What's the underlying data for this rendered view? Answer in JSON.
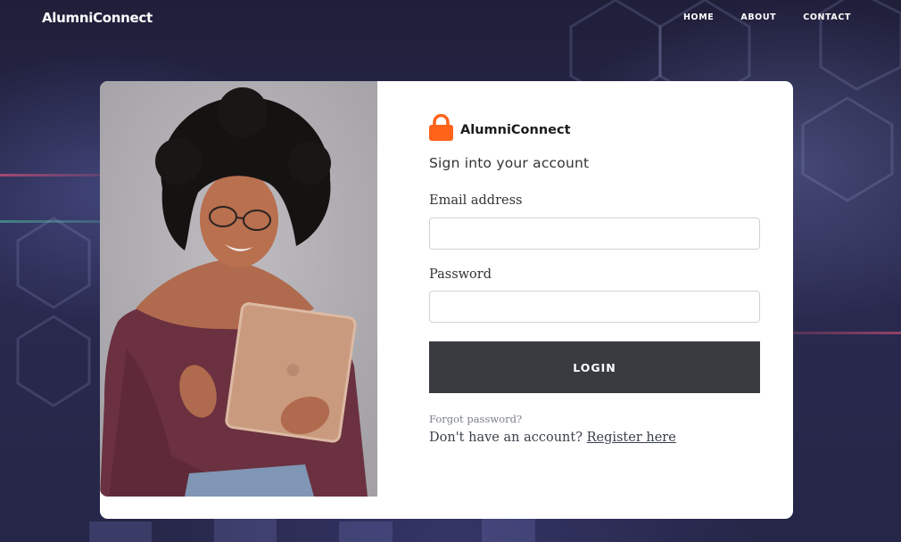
{
  "nav": {
    "brand": "AlumniConnect",
    "links": [
      "HOME",
      "ABOUT",
      "CONTACT"
    ]
  },
  "login": {
    "logo_name": "AlumniConnect",
    "subtitle": "Sign into your account",
    "email_label": "Email address",
    "email_value": "",
    "password_label": "Password",
    "password_value": "",
    "button_label": "LOGIN",
    "forgot_label": "Forgot password?",
    "register_prompt": "Don't have an account?",
    "register_link": "Register here"
  },
  "colors": {
    "lock_icon": "#ff6219",
    "login_button": "#393b41",
    "background": "#23233f"
  },
  "icons": {
    "logo": "lock-icon"
  }
}
